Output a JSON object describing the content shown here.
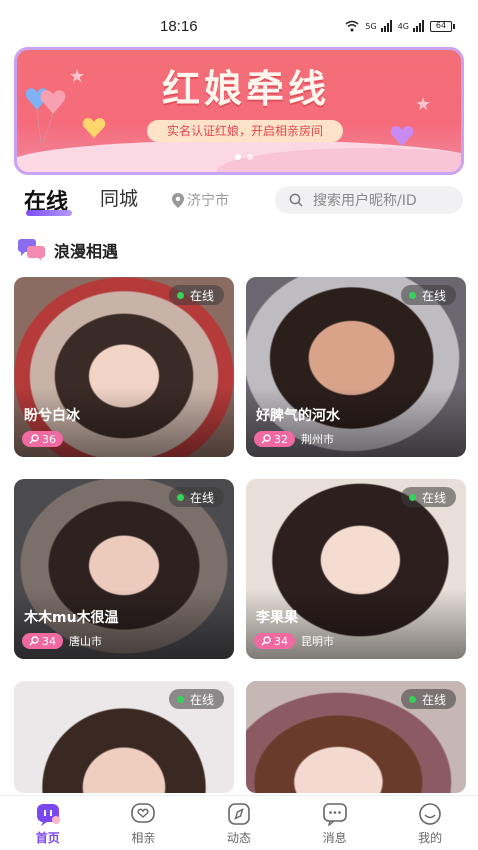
{
  "status_bar": {
    "time": "18:16",
    "net1": "5G",
    "net2": "4G",
    "battery": "64"
  },
  "banner": {
    "title": "红娘牵线",
    "subtitle": "实名认证红娘，开启相亲房间"
  },
  "tabs": {
    "online": "在线",
    "same_city": "同城"
  },
  "location": "济宁市",
  "search": {
    "placeholder": "搜索用户昵称/ID"
  },
  "section": {
    "title": "浪漫相遇"
  },
  "cards": [
    {
      "status": "在线",
      "name": "盼兮白冰",
      "age": "36",
      "city": ""
    },
    {
      "status": "在线",
      "name": "好脾气的河水",
      "age": "32",
      "city": "荆州市"
    },
    {
      "status": "在线",
      "name": "木木mu木很温",
      "age": "34",
      "city": "唐山市"
    },
    {
      "status": "在线",
      "name": "李果果",
      "age": "34",
      "city": "昆明市"
    },
    {
      "status": "在线",
      "name": "",
      "age": "",
      "city": ""
    },
    {
      "status": "在线",
      "name": "",
      "age": "",
      "city": ""
    }
  ],
  "bottom_nav": [
    {
      "label": "首页",
      "icon": "home-icon",
      "active": true
    },
    {
      "label": "相亲",
      "icon": "heart-chat-icon",
      "active": false
    },
    {
      "label": "动态",
      "icon": "compass-icon",
      "active": false
    },
    {
      "label": "消息",
      "icon": "message-icon",
      "active": false
    },
    {
      "label": "我的",
      "icon": "smile-icon",
      "active": false
    }
  ],
  "colors": {
    "accent": "#7b48f0",
    "banner": "#f36f78",
    "age_badge": "#f06aa2",
    "online_dot": "#35d35a"
  }
}
